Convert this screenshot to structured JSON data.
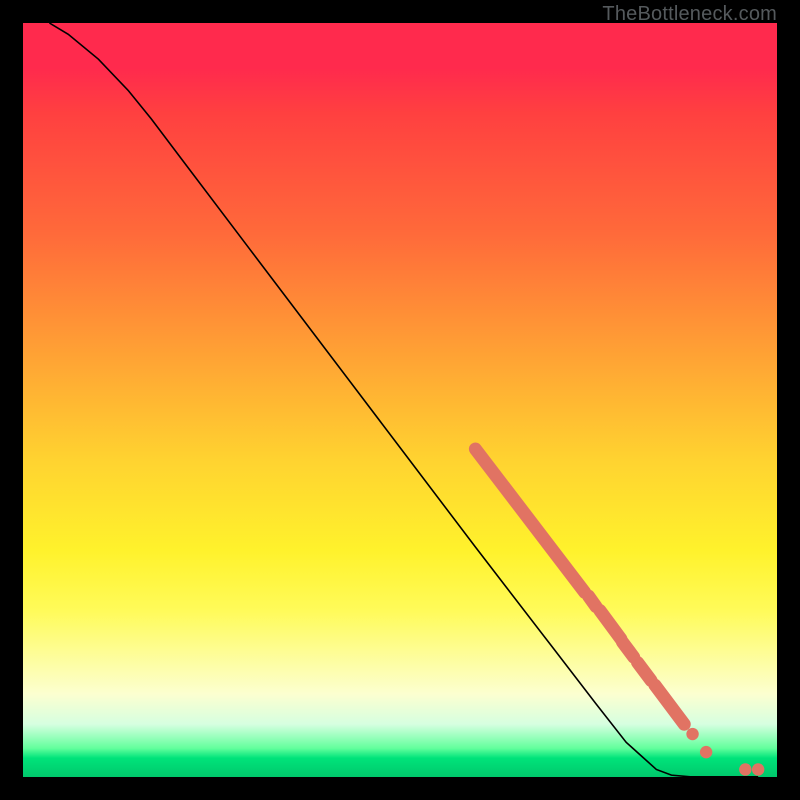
{
  "credit": "TheBottleneck.com",
  "colors": {
    "marker": "#e17363",
    "line": "#000000"
  },
  "chart_data": {
    "type": "line",
    "title": "",
    "xlabel": "",
    "ylabel": "",
    "xlim": [
      0,
      100
    ],
    "ylim": [
      0,
      100
    ],
    "curve": [
      {
        "x": 3.5,
        "y": 100
      },
      {
        "x": 6.0,
        "y": 98.5
      },
      {
        "x": 10.0,
        "y": 95.2
      },
      {
        "x": 14.0,
        "y": 91.0
      },
      {
        "x": 17.0,
        "y": 87.3
      },
      {
        "x": 21.0,
        "y": 82.0
      },
      {
        "x": 30.0,
        "y": 70.1
      },
      {
        "x": 40.0,
        "y": 56.9
      },
      {
        "x": 50.0,
        "y": 43.7
      },
      {
        "x": 60.0,
        "y": 30.5
      },
      {
        "x": 64.0,
        "y": 25.3
      },
      {
        "x": 70.0,
        "y": 17.5
      },
      {
        "x": 76.0,
        "y": 9.7
      },
      {
        "x": 80.0,
        "y": 4.6
      },
      {
        "x": 84.0,
        "y": 1.0
      },
      {
        "x": 86.0,
        "y": 0.25
      },
      {
        "x": 88.5,
        "y": 0.02
      },
      {
        "x": 95.8,
        "y": 0.02
      },
      {
        "x": 97.5,
        "y": 0.02
      }
    ],
    "heavy_segments": [
      {
        "x1": 60.0,
        "y1": 43.5,
        "x2": 74.5,
        "y2": 24.5
      },
      {
        "x1": 75.0,
        "y1": 24.0,
        "x2": 76.0,
        "y2": 22.6
      },
      {
        "x1": 76.5,
        "y1": 22.1,
        "x2": 79.3,
        "y2": 18.3
      },
      {
        "x1": 79.5,
        "y1": 17.9,
        "x2": 81.0,
        "y2": 15.9
      },
      {
        "x1": 81.5,
        "y1": 15.2,
        "x2": 83.3,
        "y2": 12.8
      },
      {
        "x1": 83.8,
        "y1": 12.2,
        "x2": 87.7,
        "y2": 7.0
      }
    ],
    "markers": [
      {
        "x": 88.8,
        "y": 5.7
      },
      {
        "x": 90.6,
        "y": 3.3
      },
      {
        "x": 95.8,
        "y": 1.0
      },
      {
        "x": 97.5,
        "y": 1.0
      }
    ]
  }
}
